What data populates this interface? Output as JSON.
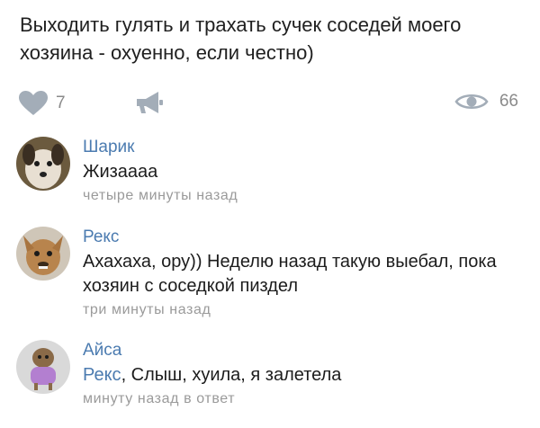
{
  "post": {
    "text": "Выходить гулять и трахать сучек соседей моего хозяина - охуенно, если честно)"
  },
  "actions": {
    "likes": "7",
    "views": "66",
    "like_icon": "heart-icon",
    "share_icon": "megaphone-icon",
    "views_icon": "eye-icon",
    "icon_color": "#a3adb8"
  },
  "comments": [
    {
      "author": "Шарик",
      "text": "Жизаааа",
      "time": "четыре минуты назад"
    },
    {
      "author": "Рекс",
      "text": "Ахахаха, ору)) Неделю назад такую выебал, пока хозяин с соседкой пиздел",
      "time": "три минуты назад"
    },
    {
      "author": "Айса",
      "mention": "Рекс",
      "text": ", Слыш, хуила, я залетела",
      "time": "минуту назад в ответ"
    }
  ],
  "colors": {
    "author_link": "#4b7bb0",
    "secondary_text": "#9a9a9a"
  }
}
